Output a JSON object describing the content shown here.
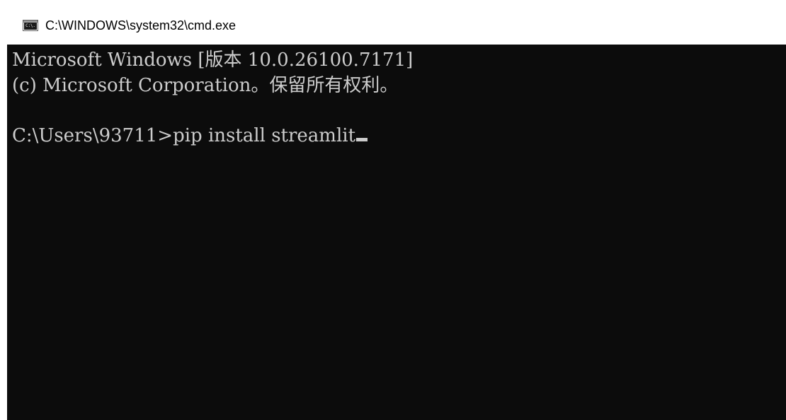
{
  "window": {
    "title": "C:\\WINDOWS\\system32\\cmd.exe",
    "icon": "cmd-console-icon",
    "icon_glyph": "C:\\."
  },
  "console": {
    "lines": [
      "Microsoft Windows [版本 10.0.26100.7171]",
      "(c) Microsoft Corporation。保留所有权利。",
      "",
      "C:\\Users\\93711>pip install streamlit"
    ]
  },
  "colors": {
    "console_background": "#0c0c0c",
    "console_text": "#cccccc",
    "title_bar": "#ffffff"
  }
}
